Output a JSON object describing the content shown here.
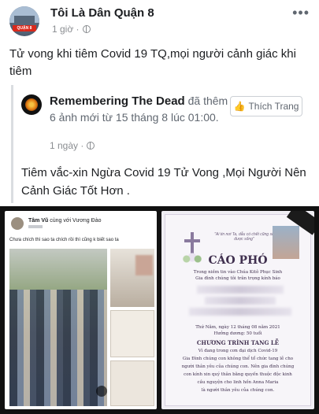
{
  "post": {
    "page_name": "Tôi Là Dân Quận 8",
    "avatar_tag": "QUẬN 8",
    "time": "1 giờ ·",
    "more": "•••",
    "caption": "Tử vong khi tiêm Covid 19 TQ,mọi người cảnh giác khi tiêm"
  },
  "shared": {
    "page_name": "Remembering The Dead",
    "action": " đã thêm 6 ảnh mới từ 15 tháng 8 lúc 01:00.",
    "time": "1 ngày ·",
    "like_label": "Thích Trang",
    "text": "Tiêm vắc-xin Ngừa Covid 19 Tử Vong ,Mọi Người Nên Cảnh Giác Tốt Hơn ."
  },
  "image": {
    "left_name": "Tâm Vũ",
    "left_with": " cùng với Vương Đào",
    "left_caption": "Chưa chích thì sao ta chích rồi thì cũng k biết sao ta",
    "right_quote": "\"Ai tin nơi Ta, dẫu có chết cũng sẽ được sống\"",
    "right_title": "CÁO PHÓ",
    "right_line1": "Trong niềm tin vào Chúa Kitô Phục Sinh",
    "right_line2": "Gia đình chúng tôi trân trọng kính báo",
    "right_date": "Thứ Năm, ngày 12 tháng 08 năm 2021",
    "right_age": "Hưởng dương: 50 tuổi",
    "right_program": "CHƯƠNG TRÌNH TANG LỄ",
    "right_pandemic": "Vì đang trong cơn đại dịch Covid-19",
    "right_body1": "Gia Đình chúng con không thể tổ chức tang lễ cho",
    "right_body2": "người thân yêu của chúng con. Nên gia đình chúng",
    "right_body3": "con kính xin quý thân bằng quyến thuộc độc kinh",
    "right_body4": "cầu nguyện cho linh hồn Anna Maria",
    "right_body5": "là người thân yêu của chúng con."
  }
}
